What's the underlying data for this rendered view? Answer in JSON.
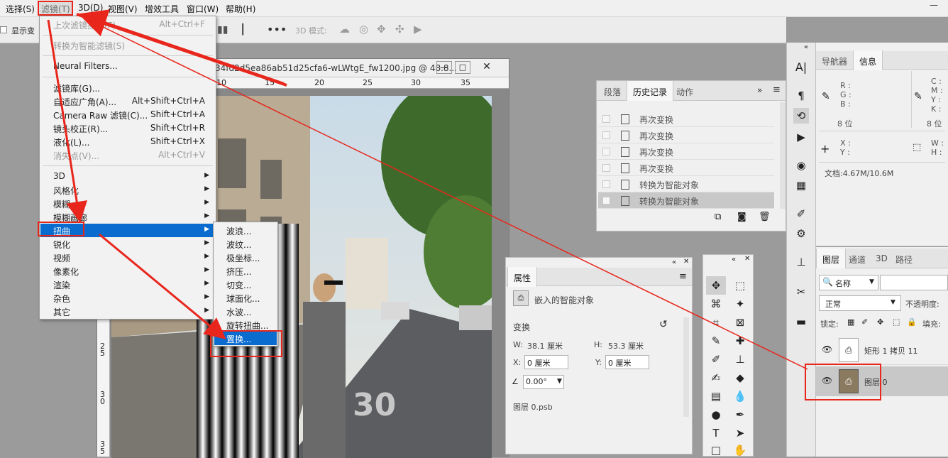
{
  "menubar": {
    "items": [
      "选择(S)",
      "滤镜(T)",
      "3D(D)",
      "视图(V)",
      "增效工具",
      "窗口(W)",
      "帮助(H)"
    ]
  },
  "options_bar": {
    "show_transform": "显示变",
    "mode_3d": "3D 模式:"
  },
  "filter_menu": {
    "last_filter": {
      "label": "上次滤镜操作(F)",
      "shortcut": "Alt+Ctrl+F"
    },
    "convert_smart": "转换为智能滤镜(S)",
    "neural": "Neural Filters...",
    "items": [
      {
        "label": "滤镜库(G)...",
        "shortcut": ""
      },
      {
        "label": "自适应广角(A)...",
        "shortcut": "Alt+Shift+Ctrl+A"
      },
      {
        "label": "Camera Raw 滤镜(C)...",
        "shortcut": "Shift+Ctrl+A"
      },
      {
        "label": "镜头校正(R)...",
        "shortcut": "Shift+Ctrl+R"
      },
      {
        "label": "液化(L)...",
        "shortcut": "Shift+Ctrl+X"
      },
      {
        "label": "消失点(V)...",
        "shortcut": "Alt+Ctrl+V"
      }
    ],
    "submenus": [
      "3D",
      "风格化",
      "模糊",
      "模糊画廊",
      "扭曲",
      "锐化",
      "视频",
      "像素化",
      "渲染",
      "杂色",
      "其它"
    ],
    "selected": "扭曲"
  },
  "distort_submenu": {
    "items": [
      "波浪...",
      "波纹...",
      "极坐标...",
      "挤压...",
      "切变...",
      "球面化...",
      "水波...",
      "旋转扭曲...",
      "置换..."
    ],
    "selected": "置换..."
  },
  "document": {
    "title": "34fd2d5ea86ab51d25cfa6-wLWtgE_fw1200.jpg @ 48.8...",
    "ruler_top": [
      "10",
      "15",
      "20",
      "25",
      "30",
      "35"
    ],
    "ruler_left": [
      "2\n5",
      "3\n0",
      "3\n5"
    ],
    "street_marking": "30"
  },
  "history_panel": {
    "tabs": [
      "段落",
      "历史记录",
      "动作"
    ],
    "active_tab": "历史记录",
    "rows": [
      "再次变换",
      "再次变换",
      "再次变换",
      "再次变换",
      "转换为智能对象",
      "转换为智能对象"
    ]
  },
  "properties_panel": {
    "tab": "属性",
    "type": "嵌入的智能对象",
    "transform_label": "变换",
    "w_label": "W:",
    "w_value": "38.1 厘米",
    "h_label": "H:",
    "h_value": "53.3 厘米",
    "x_label": "X:",
    "x_value": "0 厘米",
    "y_label": "Y:",
    "y_value": "0 厘米",
    "angle_value": "0.00°",
    "file": "图层 0.psb"
  },
  "info_panel": {
    "tabs": [
      "导航器",
      "信息"
    ],
    "active_tab": "信息",
    "rgb": [
      "R :",
      "G :",
      "B :"
    ],
    "bits_left": "8 位",
    "cmyk": [
      "C :",
      "M :",
      "Y :",
      "K :"
    ],
    "bits_right": "8 位",
    "xy": [
      "X :",
      "Y :"
    ],
    "wh": [
      "W :",
      "H :"
    ],
    "doc": "文档:4.67M/10.6M"
  },
  "layers_panel": {
    "tabs": [
      "图层",
      "通道",
      "3D",
      "路径"
    ],
    "active_tab": "图层",
    "filter_kind": "名称",
    "blend_mode": "正常",
    "opacity_label": "不透明度:",
    "lock_label": "锁定:",
    "fill_label": "填充:",
    "layers": [
      {
        "name": "矩形 1 拷贝 11",
        "selected": false
      },
      {
        "name": "图层 0",
        "selected": true
      }
    ]
  },
  "colors": {
    "highlight": "#0a6ccf",
    "annotation_red": "#e8261c"
  }
}
